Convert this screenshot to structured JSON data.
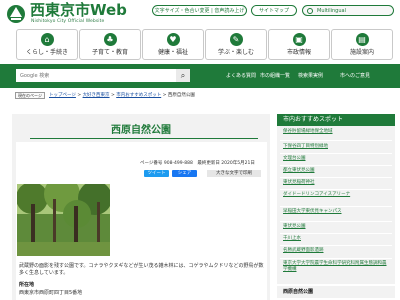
{
  "header": {
    "logo_title": "西東京市Web",
    "logo_subtitle": "Nishitokyo City Official Website",
    "text_size_label": "文字サイズ・色合い変更 | 音声読み上げ",
    "sitemap_label": "サイトマップ",
    "multilingual_label": "Multilingual"
  },
  "nav": [
    {
      "label": "くらし・手続き",
      "icon": "home-icon",
      "glyph": "⌂"
    },
    {
      "label": "子育て・教育",
      "icon": "family-icon",
      "glyph": "♣"
    },
    {
      "label": "健康・福祉",
      "icon": "heart-icon",
      "glyph": "♥"
    },
    {
      "label": "学ぶ・楽しむ",
      "icon": "book-icon",
      "glyph": "✎"
    },
    {
      "label": "市政情報",
      "icon": "city-hall-icon",
      "glyph": "▣"
    },
    {
      "label": "施設案内",
      "icon": "building-icon",
      "glyph": "▤"
    }
  ],
  "search": {
    "placeholder": "Google 検索",
    "quick_links": [
      "よくある質問",
      "市の組織一覧",
      "検索果実例",
      "市へのご意見"
    ]
  },
  "breadcrumb": {
    "current_location_label": "現在のページ",
    "items": [
      "トップページ",
      "大好き西東京",
      "市内おすすめスポット",
      "西原自然公園"
    ]
  },
  "page": {
    "title": "西原自然公園",
    "meta": "ページ番号 908-499-888　最終更新日 2020年5月21日",
    "tweet_label": "ツイート",
    "share_label": "シェア",
    "print_label": "大きな文字で印刷",
    "photo_alt": "photo",
    "body": "武蔵野の面影を残す公園です。コナラやクヌギなどが生い茂る雑木林には、コゲラやムクドリなどの野鳥が数多く生息しています。",
    "address_heading": "所在地",
    "address": "西東京市西原町四丁目5番地"
  },
  "sidebar": {
    "heading": "市内おすすめスポット",
    "items": [
      "保谷貯留場緑地保全地域",
      "下保谷四丁目特別緑地",
      "文理台公園",
      "都立東伏見公園",
      "東伏見稲荷神社",
      "ダイドードリンコアイスアリーナ",
      "早稲田大学東伏見キャンパス",
      "東伏見公園",
      "千川上水",
      "名勝武蔵野面影遺跡",
      "東京大学大学院農学生命科学研究科附属生態調和農学機構"
    ],
    "footer": "西原自然公園"
  },
  "colors": {
    "brand_green": "#1f7a3a"
  }
}
